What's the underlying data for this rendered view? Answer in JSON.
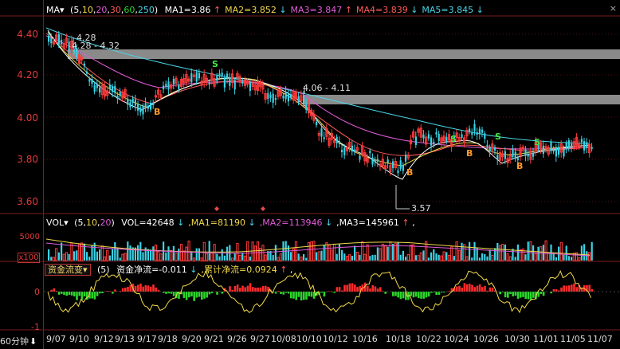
{
  "main_legend": {
    "name": "MA",
    "params_parts": [
      {
        "text": "5",
        "color": "#ffffff"
      },
      {
        "text": "10",
        "color": "#f2d94a"
      },
      {
        "text": "20",
        "color": "#e05cd8"
      },
      {
        "text": "30",
        "color": "#ff5a5a"
      },
      {
        "text": "60",
        "color": "#2bd62b"
      },
      {
        "text": "250",
        "color": "#4ad6e8"
      }
    ],
    "items": [
      {
        "label": "MA1=3.86",
        "arrow": "↑",
        "color": "#ffffff"
      },
      {
        "label": "MA2=3.852",
        "arrow": "↓",
        "color": "#f2d94a"
      },
      {
        "label": "MA3=3.847",
        "arrow": "↑",
        "color": "#e05cd8"
      },
      {
        "label": "MA4=3.839",
        "arrow": "↓",
        "color": "#ff5a5a"
      },
      {
        "label": "MA5=3.845",
        "arrow": "↓",
        "color": "#4ad6e8"
      }
    ],
    "close_icon": "×"
  },
  "vol_legend": {
    "name": "VOL",
    "params_parts": [
      {
        "text": "5",
        "color": "#ffffff"
      },
      {
        "text": "10",
        "color": "#f2d94a"
      },
      {
        "text": "20",
        "color": "#e05cd8"
      }
    ],
    "items": [
      {
        "label": "VOL=42648",
        "arrow": "↓",
        "color": "#ffffff"
      },
      {
        "label": "MA1=81190",
        "arrow": "↓",
        "color": "#f2d94a"
      },
      {
        "label": "MA2=113946",
        "arrow": "↓",
        "color": "#e05cd8"
      },
      {
        "label": "MA3=145961",
        "arrow": "↑",
        "color": "#ffffff"
      }
    ]
  },
  "flow_legend": {
    "selector_label": "资金流变",
    "param": "(5)",
    "items": [
      {
        "label": "资金净流=-0.011",
        "arrow": "↓",
        "color": "#ffffff"
      },
      {
        "label": "累计净流=0.0924",
        "arrow": "↑",
        "color": "#f2d94a"
      }
    ]
  },
  "price_axis": [
    "4.40",
    "4.20",
    "4.00",
    "3.80",
    "3.60"
  ],
  "vol_axis": [
    "5000",
    "x100"
  ],
  "flow_axis": [
    "0",
    "-1"
  ],
  "annotations": {
    "high_range": "4.28 - 4.32",
    "mid_range": "4.06 - 4.11",
    "high_value": "4.28",
    "low_value": "3.57",
    "buy_marker": "B",
    "sell_marker": "S"
  },
  "x_axis": [
    "9/07",
    "9/10",
    "9/12",
    "9/13",
    "9/17",
    "9/18",
    "9/20",
    "9/21",
    "9/26",
    "9/27",
    "10/08",
    "10/10",
    "10/12",
    "10/16",
    "10/18",
    "10/22",
    "10/24",
    "10/26",
    "10/30",
    "11/01",
    "11/05",
    "11/07"
  ],
  "period_label": "60分钟",
  "period_arrow": "⬇"
}
